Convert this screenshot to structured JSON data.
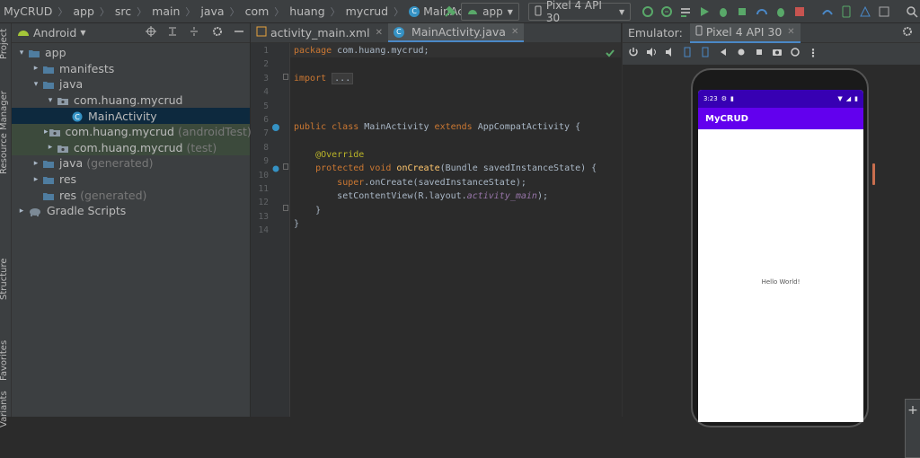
{
  "breadcrumbs": [
    "MyCRUD",
    "app",
    "src",
    "main",
    "java",
    "com",
    "huang",
    "mycrud",
    "MainActivity"
  ],
  "toolbar": {
    "run_config": "app",
    "device": "Pixel 4 API 30"
  },
  "left_strip": {
    "project": "Project",
    "resource_manager": "Resource Manager",
    "structure": "Structure",
    "favorites": "Favorites",
    "variants": "Variants"
  },
  "project_panel": {
    "view": "Android"
  },
  "tree": [
    {
      "label": "app",
      "suffix": "",
      "indent": 0,
      "arrow": "▾",
      "icon": "folder"
    },
    {
      "label": "manifests",
      "suffix": "",
      "indent": 1,
      "arrow": "▸",
      "icon": "folder"
    },
    {
      "label": "java",
      "suffix": "",
      "indent": 1,
      "arrow": "▾",
      "icon": "folder"
    },
    {
      "label": "com.huang.mycrud",
      "suffix": "",
      "indent": 2,
      "arrow": "▾",
      "icon": "package"
    },
    {
      "label": "MainActivity",
      "suffix": "",
      "indent": 3,
      "arrow": "",
      "icon": "class",
      "selected": true
    },
    {
      "label": "com.huang.mycrud",
      "suffix": "(androidTest)",
      "indent": 2,
      "arrow": "▸",
      "icon": "package",
      "green": true
    },
    {
      "label": "com.huang.mycrud",
      "suffix": "(test)",
      "indent": 2,
      "arrow": "▸",
      "icon": "package",
      "green": true
    },
    {
      "label": "java",
      "suffix": "(generated)",
      "indent": 1,
      "arrow": "▸",
      "icon": "folder"
    },
    {
      "label": "res",
      "suffix": "",
      "indent": 1,
      "arrow": "▸",
      "icon": "folder"
    },
    {
      "label": "res",
      "suffix": "(generated)",
      "indent": 1,
      "arrow": "",
      "icon": "folder"
    },
    {
      "label": "Gradle Scripts",
      "suffix": "",
      "indent": 0,
      "arrow": "▸",
      "icon": "gradle"
    }
  ],
  "tabs": [
    {
      "label": "activity_main.xml",
      "active": false
    },
    {
      "label": "MainActivity.java",
      "active": true
    }
  ],
  "line_numbers": [
    "1",
    "2",
    "3",
    "4",
    "5",
    "6",
    "7",
    "8",
    "9",
    "10",
    "11",
    "12",
    "13",
    "14"
  ],
  "code": {
    "l1a": "package",
    "l1b": " com.huang.mycrud;",
    "l3a": "import",
    "l3b": "...",
    "l7a": "public class",
    "l7b": " MainActivity ",
    "l7c": "extends",
    "l7d": " AppCompatActivity {",
    "l9": "@Override",
    "l10a": "protected void",
    "l10b": "onCreate",
    "l10c": "(Bundle savedInstanceState) {",
    "l11a": "super",
    "l11b": ".onCreate(savedInstanceState);",
    "l12a": "setContentView(R.layout.",
    "l12b": "activity_main",
    "l12c": ");",
    "l13": "}",
    "l14": "}"
  },
  "emulator": {
    "label": "Emulator:",
    "tab": "Pixel 4 API 30"
  },
  "phone": {
    "time": "3:23",
    "app_title": "MyCRUD",
    "hello": "Hello World!"
  },
  "colors": {
    "accent": "#4a88c7",
    "app_bar": "#6200ee",
    "status_bar": "#3700b3",
    "selection": "#0d293e"
  }
}
